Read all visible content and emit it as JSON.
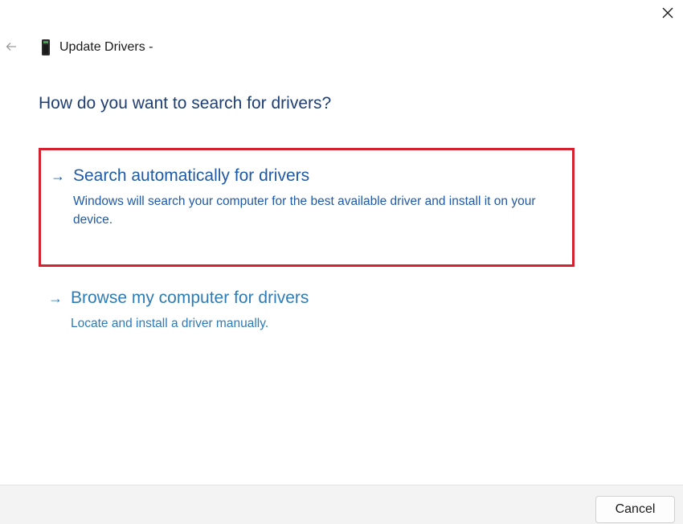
{
  "window": {
    "title": "Update Drivers -",
    "close_icon": "close-icon",
    "back_icon": "back-arrow-icon",
    "device_icon": "device-icon"
  },
  "main": {
    "question": "How do you want to search for drivers?",
    "options": [
      {
        "arrow": "→",
        "title": "Search automatically for drivers",
        "description": "Windows will search your computer for the best available driver and install it on your device.",
        "highlighted": true
      },
      {
        "arrow": "→",
        "title": "Browse my computer for drivers",
        "description": "Locate and install a driver manually.",
        "highlighted": false
      }
    ]
  },
  "footer": {
    "cancel_label": "Cancel"
  },
  "colors": {
    "accent": "#1e5aa8",
    "link": "#2d7cb8",
    "heading": "#1f3f73",
    "highlight_border": "#d4202f",
    "footer_bg": "#f3f3f3"
  }
}
